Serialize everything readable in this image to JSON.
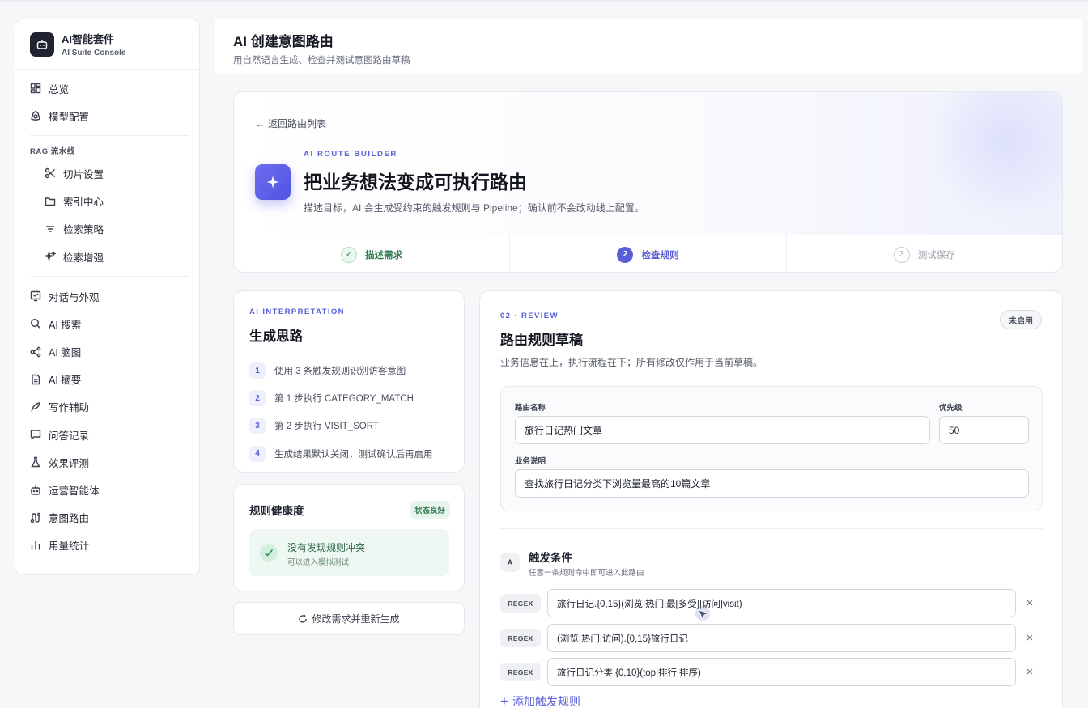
{
  "brand": {
    "title": "AI智能套件",
    "subtitle": "AI Suite Console"
  },
  "nav": {
    "top": [
      {
        "label": "总览",
        "icon": "grid-icon"
      },
      {
        "label": "模型配置",
        "icon": "model-icon"
      }
    ],
    "group_label": "RAG 流水线",
    "rag": [
      {
        "label": "切片设置",
        "icon": "scissors-icon"
      },
      {
        "label": "索引中心",
        "icon": "folder-icon"
      },
      {
        "label": "检索策略",
        "icon": "filter-icon"
      },
      {
        "label": "检索增强",
        "icon": "sparkle-icon"
      }
    ],
    "bottom": [
      {
        "label": "对话与外观",
        "icon": "chat-window-icon"
      },
      {
        "label": "AI 搜索",
        "icon": "search-icon"
      },
      {
        "label": "AI 脑图",
        "icon": "mindmap-icon"
      },
      {
        "label": "AI 摘要",
        "icon": "document-icon"
      },
      {
        "label": "写作辅助",
        "icon": "pen-icon"
      },
      {
        "label": "问答记录",
        "icon": "message-icon"
      },
      {
        "label": "效果评测",
        "icon": "flask-icon"
      },
      {
        "label": "运营智能体",
        "icon": "robot-icon"
      },
      {
        "label": "意图路由",
        "icon": "route-icon"
      },
      {
        "label": "用量统计",
        "icon": "bar-chart-icon"
      }
    ]
  },
  "header": {
    "title": "AI 创建意图路由",
    "subtitle": "用自然语言生成、检查并测试意图路由草稿"
  },
  "hero": {
    "back_label": "返回路由列表",
    "eyebrow": "AI ROUTE BUILDER",
    "title": "把业务想法变成可执行路由",
    "description": "描述目标，AI 会生成受约束的触发规则与 Pipeline；确认前不会改动线上配置。",
    "steps": [
      {
        "marker": "✓",
        "label": "描述需求",
        "state": "done"
      },
      {
        "marker": "2",
        "label": "检查规则",
        "state": "active"
      },
      {
        "marker": "3",
        "label": "测试保存",
        "state": "todo"
      }
    ]
  },
  "interpretation": {
    "eyebrow": "AI INTERPRETATION",
    "title": "生成思路",
    "items": [
      {
        "num": "1",
        "text": "使用 3 条触发规则识别访客意图"
      },
      {
        "num": "2",
        "text": "第 1 步执行 CATEGORY_MATCH"
      },
      {
        "num": "3",
        "text": "第 2 步执行 VISIT_SORT"
      },
      {
        "num": "4",
        "text": "生成结果默认关闭，测试确认后再启用"
      }
    ]
  },
  "health": {
    "title": "规则健康度",
    "badge": "状态良好",
    "message": "没有发现规则冲突",
    "hint": "可以进入模拟测试"
  },
  "regenerate_label": "修改需求并重新生成",
  "review": {
    "eyebrow": "02 · REVIEW",
    "title": "路由规则草稿",
    "description": "业务信息在上，执行流程在下；所有修改仅作用于当前草稿。",
    "status": "未启用",
    "form": {
      "name_label": "路由名称",
      "name_value": "旅行日记热门文章",
      "priority_label": "优先级",
      "priority_value": "50",
      "desc_label": "业务说明",
      "desc_value": "查找旅行日记分类下浏览量最高的10篇文章"
    },
    "trigger": {
      "badge": "A",
      "title": "触发条件",
      "subtitle": "任意一条规则命中即可进入此路由",
      "rules": [
        {
          "type": "REGEX",
          "value": "旅行日记.{0,15}(浏览|热门|最[多受]|访问|visit)"
        },
        {
          "type": "REGEX",
          "value": "(浏览|热门|访问).{0,15}旅行日记"
        },
        {
          "type": "REGEX",
          "value": "旅行日记分类.{0,10}(top|排行|排序)"
        }
      ],
      "add_label": "添加触发规则"
    }
  },
  "colors": {
    "accent": "#5a5fd8",
    "success": "#2d7a4f",
    "sidebar_logo": "#1f2430"
  }
}
